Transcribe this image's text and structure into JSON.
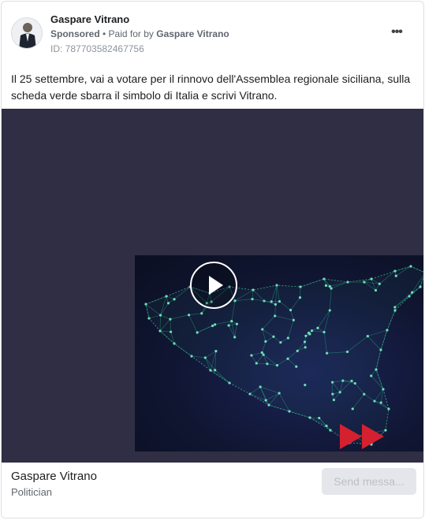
{
  "ad": {
    "page_name": "Gaspare Vitrano",
    "sponsored_label": "Sponsored",
    "separator": " • ",
    "paid_for_prefix": "Paid for by ",
    "paid_for_name": "Gaspare Vitrano",
    "ad_id": "ID: 787703582467756",
    "more_icon_text": "•••",
    "body": "Il 25 settembre, vai a votare per il rinnovo dell'Assemblea regionale siciliana, sulla scheda verde sbarra il simbolo di Italia e scrivi Vitrano."
  },
  "media": {
    "background_color": "#2f2e44",
    "video_content": "sicily-network-map",
    "play_icon": "play-icon",
    "forward_icon": "fast-forward-icon",
    "forward_color": "#d4202f"
  },
  "footer": {
    "name": "Gaspare Vitrano",
    "category": "Politician",
    "send_button": "Send messa..."
  }
}
